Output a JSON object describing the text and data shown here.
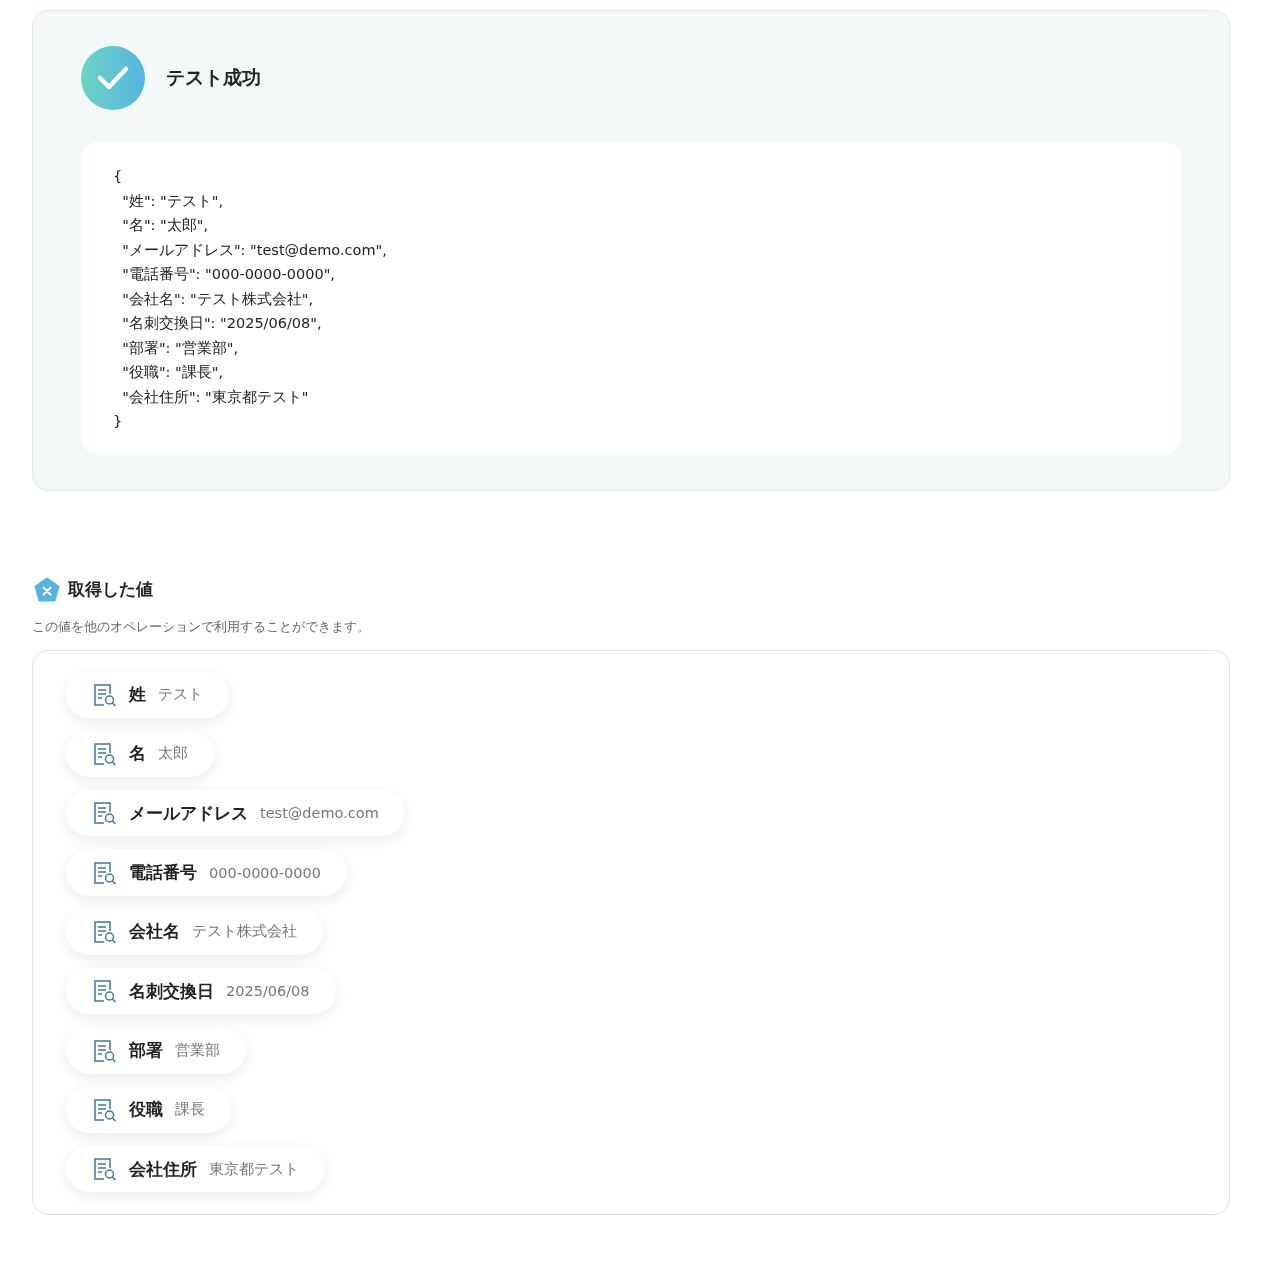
{
  "result": {
    "title": "テスト成功",
    "code_lines": [
      "{",
      "  \"姓\": \"テスト\",",
      "  \"名\": \"太郎\",",
      "  \"メールアドレス\": \"test@demo.com\",",
      "  \"電話番号\": \"000-0000-0000\",",
      "  \"会社名\": \"テスト株式会社\",",
      "  \"名刺交換日\": \"2025/06/08\",",
      "  \"部署\": \"営業部\",",
      "  \"役職\": \"課長\",",
      "  \"会社住所\": \"東京都テスト\"",
      "}"
    ]
  },
  "values": {
    "title": "取得した値",
    "description": "この値を他のオペレーションで利用することができます。",
    "items": [
      {
        "label": "姓",
        "value": "テスト"
      },
      {
        "label": "名",
        "value": "太郎"
      },
      {
        "label": "メールアドレス",
        "value": "test@demo.com"
      },
      {
        "label": "電話番号",
        "value": "000-0000-0000"
      },
      {
        "label": "会社名",
        "value": "テスト株式会社"
      },
      {
        "label": "名刺交換日",
        "value": "2025/06/08"
      },
      {
        "label": "部署",
        "value": "営業部"
      },
      {
        "label": "役職",
        "value": "課長"
      },
      {
        "label": "会社住所",
        "value": "東京都テスト"
      }
    ]
  }
}
